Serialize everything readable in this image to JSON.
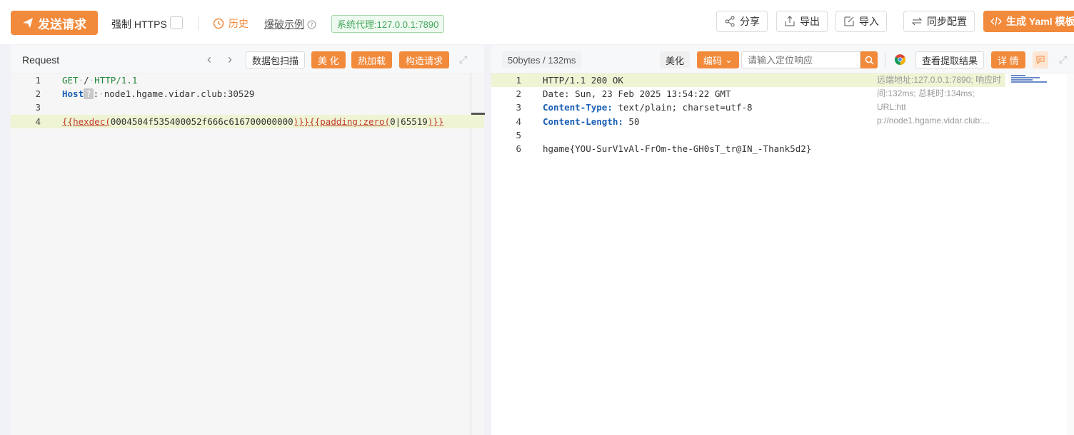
{
  "toolbar": {
    "send_label": "发送请求",
    "https_label": "强制 HTTPS",
    "history_label": "历史",
    "fuzz_label": "爆破示例",
    "proxy_label": "系统代理:127.0.0.1:7890",
    "share_label": "分享",
    "export_label": "导出",
    "import_label": "导入",
    "sync_label": "同步配置",
    "yaml_label": "生成 Yaml 模板"
  },
  "request": {
    "title": "Request",
    "scan_label": "数据包扫描",
    "beautify_label": "美 化",
    "hotload_label": "热加载",
    "build_label": "构造请求",
    "lines": [
      {
        "num": "1"
      },
      {
        "num": "2"
      },
      {
        "num": "3"
      },
      {
        "num": "4"
      }
    ],
    "line1": {
      "method": "GET",
      "path": "/",
      "proto": "HTTP/1.1"
    },
    "line2": {
      "key": "Host",
      "value": "node1.hgame.vidar.club:30529"
    },
    "line4": {
      "hexdec_fn": "hexdec",
      "hex_value": "0004504f535400052f666c616700000000",
      "padding_fn": "padding:zero",
      "pad_arg1": "0",
      "pad_arg2": "65519"
    }
  },
  "response": {
    "stats": "50bytes / 132ms",
    "beautify_label": "美化",
    "encoding_label": "编码",
    "search_placeholder": "请输入定位响应",
    "extract_label": "查看提取结果",
    "detail_label": "详 情",
    "lines": [
      {
        "num": "1"
      },
      {
        "num": "2"
      },
      {
        "num": "3"
      },
      {
        "num": "4"
      },
      {
        "num": "5"
      },
      {
        "num": "6"
      }
    ],
    "line1": "HTTP/1.1 200 OK",
    "line2": "Date: Sun, 23 Feb 2025 13:54:22 GMT",
    "line3": {
      "key": "Content-Type:",
      "value": "text/plain; charset=utf-8"
    },
    "line4": {
      "key": "Content-Length:",
      "value": "50"
    },
    "line6": "hgame{YOU-SurV1vAl-FrOm-the-GH0sT_tr@IN_-Thank5d2}",
    "side_info": [
      "远端地址:127.0.0.1:7890; 响应时",
      "间:132ms; 总耗时:134ms; URL:htt",
      "p://node1.hgame.vidar.club:..."
    ]
  },
  "colors": {
    "accent": "#f28a3c",
    "proxy_green": "#43a65a",
    "keyword_blue": "#1a5fb4"
  }
}
